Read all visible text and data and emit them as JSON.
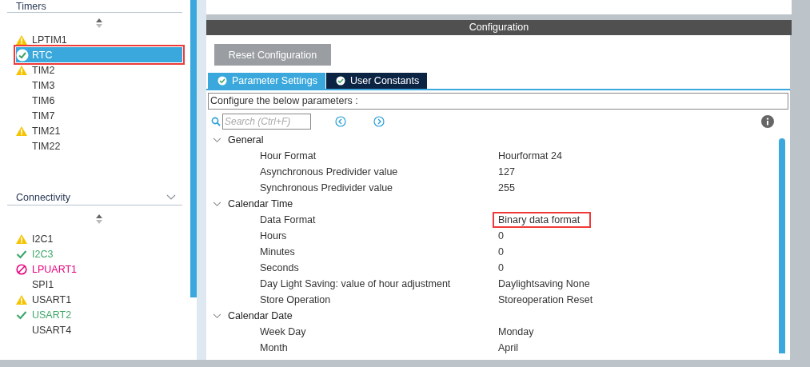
{
  "sidebar": {
    "sections": [
      {
        "title": "Timers",
        "expanded": true,
        "items": [
          {
            "label": "LPTIM1",
            "kind": "warning",
            "selected": false,
            "highlighted": false
          },
          {
            "label": "RTC",
            "kind": "ok",
            "selected": true,
            "highlighted": true
          },
          {
            "label": "TIM2",
            "kind": "warning",
            "selected": false,
            "highlighted": false
          },
          {
            "label": "TIM3",
            "kind": "plain",
            "selected": false,
            "highlighted": false
          },
          {
            "label": "TIM6",
            "kind": "plain",
            "selected": false,
            "highlighted": false
          },
          {
            "label": "TIM7",
            "kind": "plain",
            "selected": false,
            "highlighted": false
          },
          {
            "label": "TIM21",
            "kind": "warning",
            "selected": false,
            "highlighted": false
          },
          {
            "label": "TIM22",
            "kind": "plain",
            "selected": false,
            "highlighted": false
          }
        ]
      },
      {
        "title": "Connectivity",
        "expanded": true,
        "items": [
          {
            "label": "I2C1",
            "kind": "warning",
            "selected": false,
            "highlighted": false
          },
          {
            "label": "I2C3",
            "kind": "enabled",
            "selected": false,
            "highlighted": false
          },
          {
            "label": "LPUART1",
            "kind": "error",
            "selected": false,
            "highlighted": false
          },
          {
            "label": "SPI1",
            "kind": "plain",
            "selected": false,
            "highlighted": false
          },
          {
            "label": "USART1",
            "kind": "warning",
            "selected": false,
            "highlighted": false
          },
          {
            "label": "USART2",
            "kind": "enabled",
            "selected": false,
            "highlighted": false
          },
          {
            "label": "USART4",
            "kind": "plain",
            "selected": false,
            "highlighted": false
          }
        ]
      }
    ]
  },
  "configuration": {
    "title": "Configuration",
    "reset_button": "Reset Configuration",
    "tabs": [
      {
        "label": "Parameter Settings",
        "selected": true
      },
      {
        "label": "User Constants",
        "selected": false
      }
    ],
    "hint": "Configure the below parameters :",
    "search": {
      "placeholder": "Search (Ctrl+F)"
    },
    "groups": [
      {
        "name": "General",
        "expanded": true,
        "rows": [
          {
            "label": "Hour Format",
            "value": "Hourformat 24",
            "highlighted": false
          },
          {
            "label": "Asynchronous Predivider value",
            "value": "127",
            "highlighted": false
          },
          {
            "label": "Synchronous Predivider value",
            "value": "255",
            "highlighted": false
          }
        ]
      },
      {
        "name": "Calendar Time",
        "expanded": true,
        "rows": [
          {
            "label": "Data Format",
            "value": "Binary data format",
            "highlighted": true
          },
          {
            "label": "Hours",
            "value": "0",
            "highlighted": false
          },
          {
            "label": "Minutes",
            "value": "0",
            "highlighted": false
          },
          {
            "label": "Seconds",
            "value": "0",
            "highlighted": false
          },
          {
            "label": "Day Light Saving: value of hour adjustment",
            "value": "Daylightsaving None",
            "highlighted": false
          },
          {
            "label": "Store Operation",
            "value": "Storeoperation Reset",
            "highlighted": false
          }
        ]
      },
      {
        "name": "Calendar Date",
        "expanded": true,
        "rows": [
          {
            "label": "Week Day",
            "value": "Monday",
            "highlighted": false
          },
          {
            "label": "Month",
            "value": "April",
            "highlighted": false
          }
        ]
      }
    ]
  }
}
